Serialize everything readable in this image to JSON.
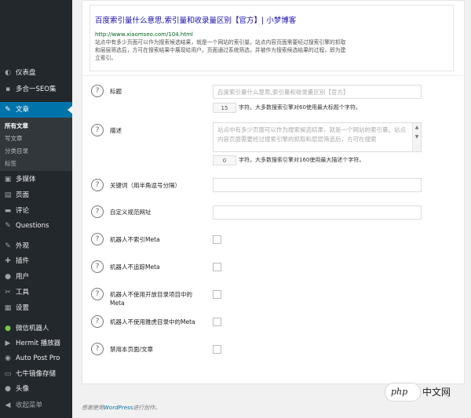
{
  "sidebar": {
    "items": [
      {
        "label": "仪表盘",
        "icon": "dashboard-icon",
        "glyph": "◐"
      },
      {
        "label": "多合一SEO集",
        "icon": "seo-pack-icon",
        "glyph": "▪"
      },
      {
        "label": "文章",
        "icon": "pin-icon",
        "glyph": "✎"
      },
      {
        "label": "多媒体",
        "icon": "media-icon",
        "glyph": "▣"
      },
      {
        "label": "页面",
        "icon": "pages-icon",
        "glyph": "▤"
      },
      {
        "label": "评论",
        "icon": "comments-icon",
        "glyph": "▬"
      },
      {
        "label": "Questions",
        "icon": "questions-pin-icon",
        "glyph": "✎"
      },
      {
        "label": "外观",
        "icon": "appearance-icon",
        "glyph": "✎"
      },
      {
        "label": "插件",
        "icon": "plugins-icon",
        "glyph": "✚"
      },
      {
        "label": "用户",
        "icon": "users-icon",
        "glyph": "●"
      },
      {
        "label": "工具",
        "icon": "tools-icon",
        "glyph": "✂"
      },
      {
        "label": "设置",
        "icon": "settings-icon",
        "glyph": "▦"
      },
      {
        "label": "微信机器人",
        "icon": "wechat-icon",
        "glyph": "●"
      },
      {
        "label": "Hermit 播放器",
        "icon": "player-icon",
        "glyph": "▶"
      },
      {
        "label": "Auto Post Pro",
        "icon": "autopost-icon",
        "glyph": "◉"
      },
      {
        "label": "七牛镜像存储",
        "icon": "storage-icon",
        "glyph": "▭"
      },
      {
        "label": "头像",
        "icon": "avatar-icon",
        "glyph": "●"
      },
      {
        "label": "收起菜单",
        "icon": "collapse-icon",
        "glyph": "◀"
      }
    ],
    "submenu": [
      "所有文章",
      "写文章",
      "分类目录",
      "标签"
    ]
  },
  "preview": {
    "title": "百度索引量什么意思,索引量和收录量区别【官方】| 小梦博客",
    "url": "http://www.xiaomseo.com/104.html",
    "description": "站点中有多少页面可以作为搜索候选结果，就是一个网站的索引量。站点内容页面需要经过搜索引擎的抓取和层层筛选后，方可在搜索结果中展现给用户。页面通过系统筛选，并被作为搜索候选结果的过程，即为建立索引。"
  },
  "fields": {
    "help_glyph": "?",
    "title_label": "标题",
    "title_placeholder": "百度索引量什么意思,索引量和收录量区别【官方】",
    "title_count": "15",
    "title_note": "字符。大多数搜索引擎对60使用最大标题个字符。",
    "desc_label": "描述",
    "desc_placeholder": "站点中有多少页面可以作为搜索候选结果，就是一个网站的索引量。站点内容页面需要经过搜索引擎的抓取和层层筛选后，方可在搜索",
    "desc_count": "0",
    "desc_note": "字符。大多数搜索引擎对160使用最大描述个字符。",
    "keywords_label": "关键词（用半角逗号分隔）",
    "canonical_label": "自定义规范网址",
    "noindex_label": "机器人不索引Meta",
    "nofollow_label": "机器人不追踪Meta",
    "noodp_label": "机器人不使用开放目录项目中的Meta",
    "noydir_label": "机器人不使用雅虎目录中的Meta",
    "disable_label": "禁用本页面/文章"
  },
  "footer": {
    "prefix": "感谢使用",
    "link": "WordPress",
    "suffix": "进行创作。"
  },
  "watermark": {
    "logo": "php",
    "text": "中文网"
  },
  "colors": {
    "sidebar": "#23282d",
    "active": "#0073aa",
    "link": "#1a0dab",
    "url": "#006621"
  }
}
